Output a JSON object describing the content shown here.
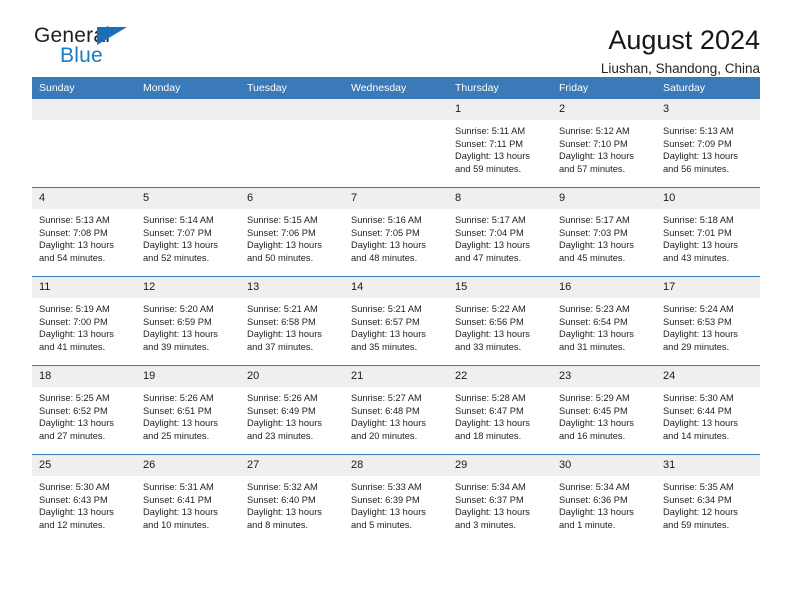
{
  "brand": {
    "name_top": "General",
    "name_bottom": "Blue",
    "flag_icon": "triangle-flag-icon",
    "color_text": "#231f20",
    "color_accent": "#1a7cc3"
  },
  "header": {
    "title": "August 2024",
    "subtitle": "Liushan, Shandong, China"
  },
  "theme": {
    "header_bg": "#3a7ab8",
    "header_text": "#ffffff",
    "daynum_bg": "#efefef",
    "cell_bg": "#ffffff",
    "grid_line": "#3a7ab8"
  },
  "calendar": {
    "weekday_headers": [
      "Sunday",
      "Monday",
      "Tuesday",
      "Wednesday",
      "Thursday",
      "Friday",
      "Saturday"
    ],
    "labels": {
      "sunrise": "Sunrise:",
      "sunset": "Sunset:",
      "daylight": "Daylight:"
    },
    "weeks": [
      [
        {
          "day": "",
          "empty": true
        },
        {
          "day": "",
          "empty": true
        },
        {
          "day": "",
          "empty": true
        },
        {
          "day": "",
          "empty": true
        },
        {
          "day": "1",
          "sunrise": "Sunrise: 5:11 AM",
          "sunset": "Sunset: 7:11 PM",
          "daylight": "Daylight: 13 hours and 59 minutes."
        },
        {
          "day": "2",
          "sunrise": "Sunrise: 5:12 AM",
          "sunset": "Sunset: 7:10 PM",
          "daylight": "Daylight: 13 hours and 57 minutes."
        },
        {
          "day": "3",
          "sunrise": "Sunrise: 5:13 AM",
          "sunset": "Sunset: 7:09 PM",
          "daylight": "Daylight: 13 hours and 56 minutes."
        }
      ],
      [
        {
          "day": "4",
          "sunrise": "Sunrise: 5:13 AM",
          "sunset": "Sunset: 7:08 PM",
          "daylight": "Daylight: 13 hours and 54 minutes."
        },
        {
          "day": "5",
          "sunrise": "Sunrise: 5:14 AM",
          "sunset": "Sunset: 7:07 PM",
          "daylight": "Daylight: 13 hours and 52 minutes."
        },
        {
          "day": "6",
          "sunrise": "Sunrise: 5:15 AM",
          "sunset": "Sunset: 7:06 PM",
          "daylight": "Daylight: 13 hours and 50 minutes."
        },
        {
          "day": "7",
          "sunrise": "Sunrise: 5:16 AM",
          "sunset": "Sunset: 7:05 PM",
          "daylight": "Daylight: 13 hours and 48 minutes."
        },
        {
          "day": "8",
          "sunrise": "Sunrise: 5:17 AM",
          "sunset": "Sunset: 7:04 PM",
          "daylight": "Daylight: 13 hours and 47 minutes."
        },
        {
          "day": "9",
          "sunrise": "Sunrise: 5:17 AM",
          "sunset": "Sunset: 7:03 PM",
          "daylight": "Daylight: 13 hours and 45 minutes."
        },
        {
          "day": "10",
          "sunrise": "Sunrise: 5:18 AM",
          "sunset": "Sunset: 7:01 PM",
          "daylight": "Daylight: 13 hours and 43 minutes."
        }
      ],
      [
        {
          "day": "11",
          "sunrise": "Sunrise: 5:19 AM",
          "sunset": "Sunset: 7:00 PM",
          "daylight": "Daylight: 13 hours and 41 minutes."
        },
        {
          "day": "12",
          "sunrise": "Sunrise: 5:20 AM",
          "sunset": "Sunset: 6:59 PM",
          "daylight": "Daylight: 13 hours and 39 minutes."
        },
        {
          "day": "13",
          "sunrise": "Sunrise: 5:21 AM",
          "sunset": "Sunset: 6:58 PM",
          "daylight": "Daylight: 13 hours and 37 minutes."
        },
        {
          "day": "14",
          "sunrise": "Sunrise: 5:21 AM",
          "sunset": "Sunset: 6:57 PM",
          "daylight": "Daylight: 13 hours and 35 minutes."
        },
        {
          "day": "15",
          "sunrise": "Sunrise: 5:22 AM",
          "sunset": "Sunset: 6:56 PM",
          "daylight": "Daylight: 13 hours and 33 minutes."
        },
        {
          "day": "16",
          "sunrise": "Sunrise: 5:23 AM",
          "sunset": "Sunset: 6:54 PM",
          "daylight": "Daylight: 13 hours and 31 minutes."
        },
        {
          "day": "17",
          "sunrise": "Sunrise: 5:24 AM",
          "sunset": "Sunset: 6:53 PM",
          "daylight": "Daylight: 13 hours and 29 minutes."
        }
      ],
      [
        {
          "day": "18",
          "sunrise": "Sunrise: 5:25 AM",
          "sunset": "Sunset: 6:52 PM",
          "daylight": "Daylight: 13 hours and 27 minutes."
        },
        {
          "day": "19",
          "sunrise": "Sunrise: 5:26 AM",
          "sunset": "Sunset: 6:51 PM",
          "daylight": "Daylight: 13 hours and 25 minutes."
        },
        {
          "day": "20",
          "sunrise": "Sunrise: 5:26 AM",
          "sunset": "Sunset: 6:49 PM",
          "daylight": "Daylight: 13 hours and 23 minutes."
        },
        {
          "day": "21",
          "sunrise": "Sunrise: 5:27 AM",
          "sunset": "Sunset: 6:48 PM",
          "daylight": "Daylight: 13 hours and 20 minutes."
        },
        {
          "day": "22",
          "sunrise": "Sunrise: 5:28 AM",
          "sunset": "Sunset: 6:47 PM",
          "daylight": "Daylight: 13 hours and 18 minutes."
        },
        {
          "day": "23",
          "sunrise": "Sunrise: 5:29 AM",
          "sunset": "Sunset: 6:45 PM",
          "daylight": "Daylight: 13 hours and 16 minutes."
        },
        {
          "day": "24",
          "sunrise": "Sunrise: 5:30 AM",
          "sunset": "Sunset: 6:44 PM",
          "daylight": "Daylight: 13 hours and 14 minutes."
        }
      ],
      [
        {
          "day": "25",
          "sunrise": "Sunrise: 5:30 AM",
          "sunset": "Sunset: 6:43 PM",
          "daylight": "Daylight: 13 hours and 12 minutes."
        },
        {
          "day": "26",
          "sunrise": "Sunrise: 5:31 AM",
          "sunset": "Sunset: 6:41 PM",
          "daylight": "Daylight: 13 hours and 10 minutes."
        },
        {
          "day": "27",
          "sunrise": "Sunrise: 5:32 AM",
          "sunset": "Sunset: 6:40 PM",
          "daylight": "Daylight: 13 hours and 8 minutes."
        },
        {
          "day": "28",
          "sunrise": "Sunrise: 5:33 AM",
          "sunset": "Sunset: 6:39 PM",
          "daylight": "Daylight: 13 hours and 5 minutes."
        },
        {
          "day": "29",
          "sunrise": "Sunrise: 5:34 AM",
          "sunset": "Sunset: 6:37 PM",
          "daylight": "Daylight: 13 hours and 3 minutes."
        },
        {
          "day": "30",
          "sunrise": "Sunrise: 5:34 AM",
          "sunset": "Sunset: 6:36 PM",
          "daylight": "Daylight: 13 hours and 1 minute."
        },
        {
          "day": "31",
          "sunrise": "Sunrise: 5:35 AM",
          "sunset": "Sunset: 6:34 PM",
          "daylight": "Daylight: 12 hours and 59 minutes."
        }
      ]
    ]
  }
}
